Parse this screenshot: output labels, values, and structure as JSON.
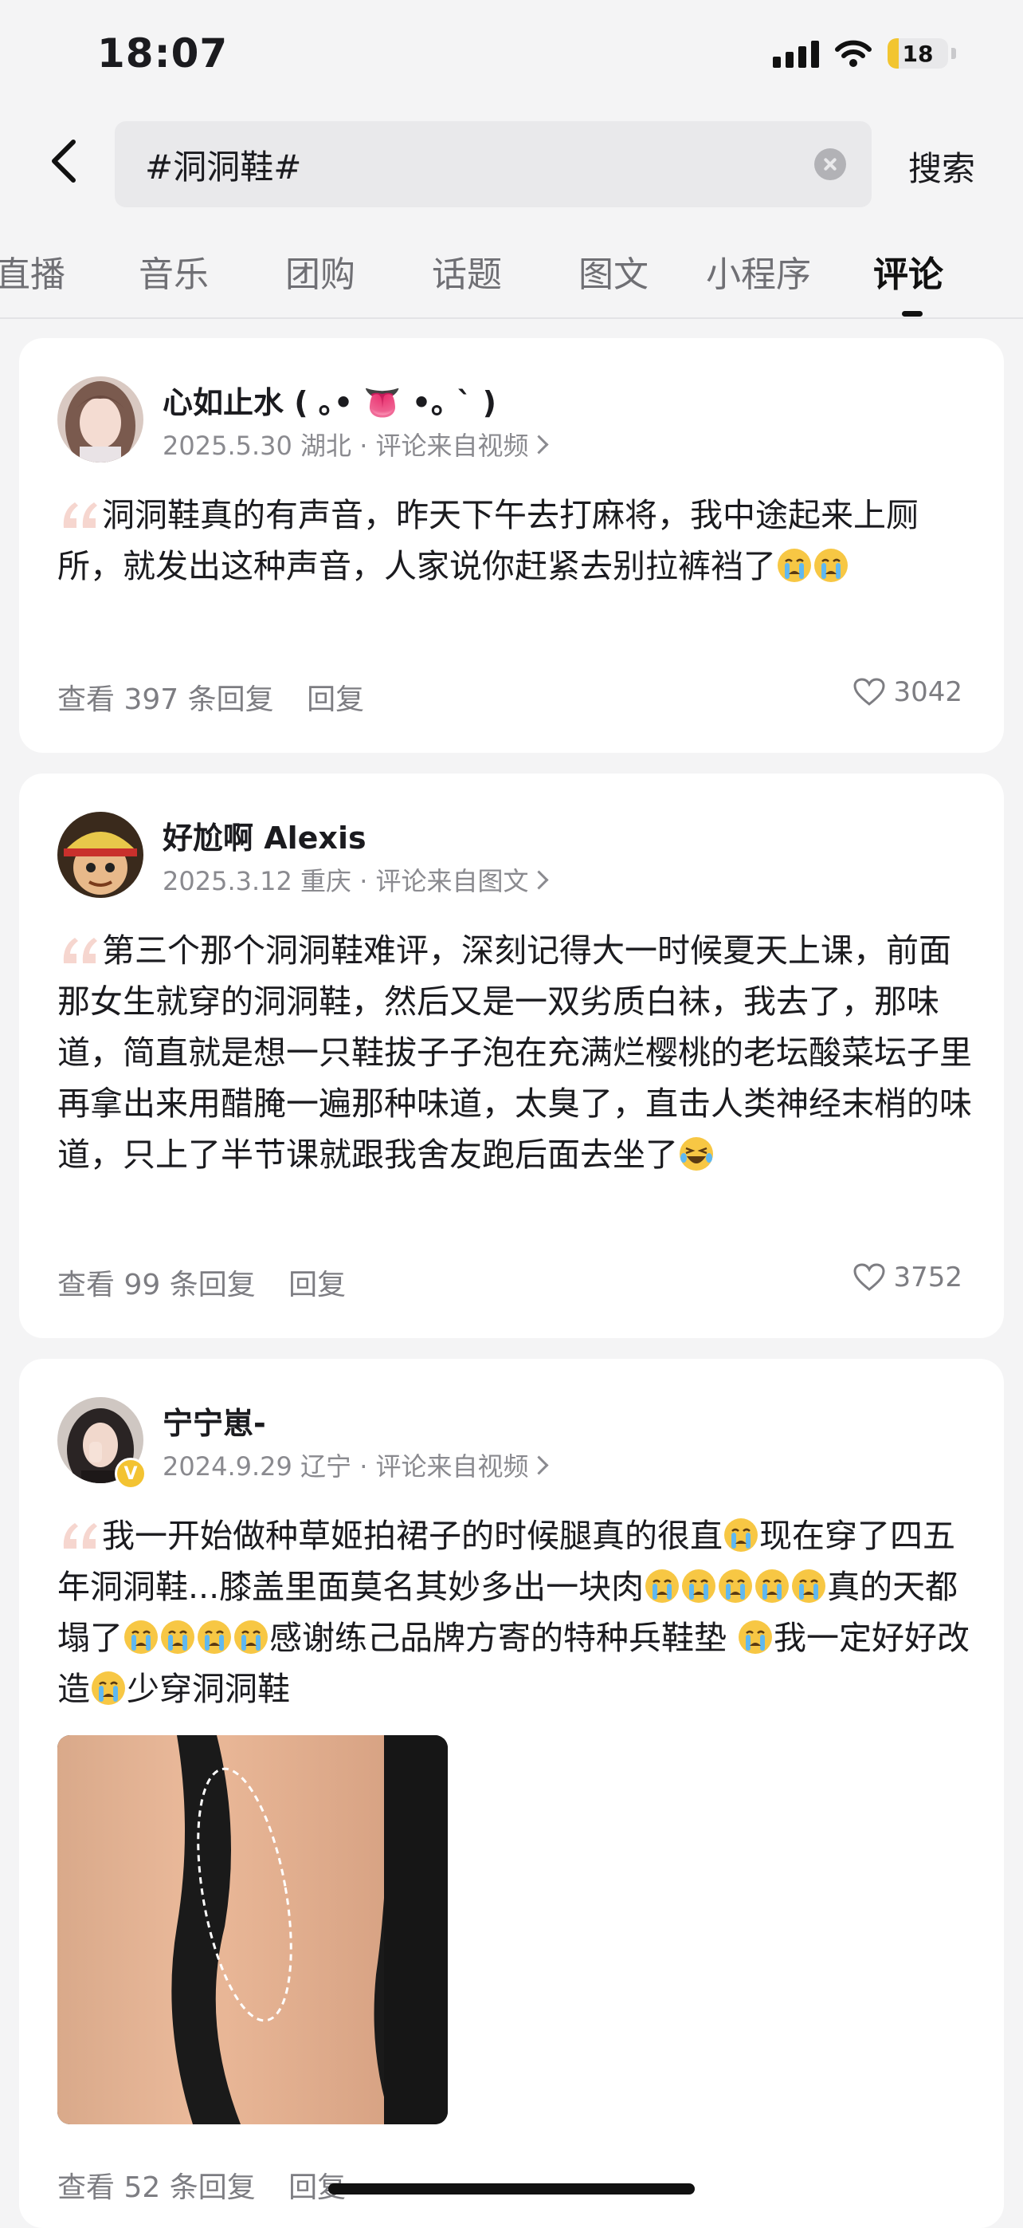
{
  "status_bar": {
    "time": "18:07",
    "battery": "18"
  },
  "search": {
    "query": "#洞洞鞋#",
    "button": "搜索"
  },
  "tabs": [
    {
      "label": "直播"
    },
    {
      "label": "音乐"
    },
    {
      "label": "团购"
    },
    {
      "label": "话题"
    },
    {
      "label": "图文"
    },
    {
      "label": "小程序"
    },
    {
      "label": "评论",
      "active": true
    }
  ],
  "comments": [
    {
      "username": "心如止水 ( ｡• 👅 •｡ ` )",
      "meta": "2025.5.30 湖北 · 评论来自视频",
      "text": "洞洞鞋真的有声音，昨天下午去打麻将，我中途起来上厕所，就发出这种声音，人家说你赶紧去别拉裤裆了",
      "replies_link": "查看 397 条回复",
      "reply": "回复",
      "likes": "3042"
    },
    {
      "username": "好尬啊 Alexis",
      "meta": "2025.3.12 重庆 · 评论来自图文",
      "text": "第三个那个洞洞鞋难评，深刻记得大一时候夏天上课，前面那女生就穿的洞洞鞋，然后又是一双劣质白袜，我去了，那味道，简直就是想一只鞋拔子子泡在充满烂樱桃的老坛酸菜坛子里再拿出来用醋腌一遍那种味道，太臭了，直击人类神经末梢的味道，只上了半节课就跟我舍友跑后面去坐了",
      "replies_link": "查看 99 条回复",
      "reply": "回复",
      "likes": "3752"
    },
    {
      "username": "宁宁崽-",
      "meta": "2024.9.29 辽宁 · 评论来自视频",
      "text_parts": [
        "我一开始做种草姬拍裙子的时候腿真的很直",
        "现在穿了四五年洞洞鞋...膝盖里面莫名其妙多出一块肉",
        "真的天都塌了",
        "感谢练己品牌方寄的特种兵鞋垫 ",
        "我一定好好改造",
        "少穿洞洞鞋"
      ],
      "badge": "V",
      "replies_link": "查看 52 条回复",
      "reply": "回复"
    }
  ],
  "colors": {
    "background": "#f4f4f5",
    "card": "#ffffff",
    "muted": "#8a8a8f",
    "battery": "#f2c530"
  },
  "icons": [
    "back-arrow-icon",
    "clear-icon",
    "heart-icon",
    "quote-icon",
    "crying-emoji-icon",
    "laughing-emoji-icon"
  ]
}
